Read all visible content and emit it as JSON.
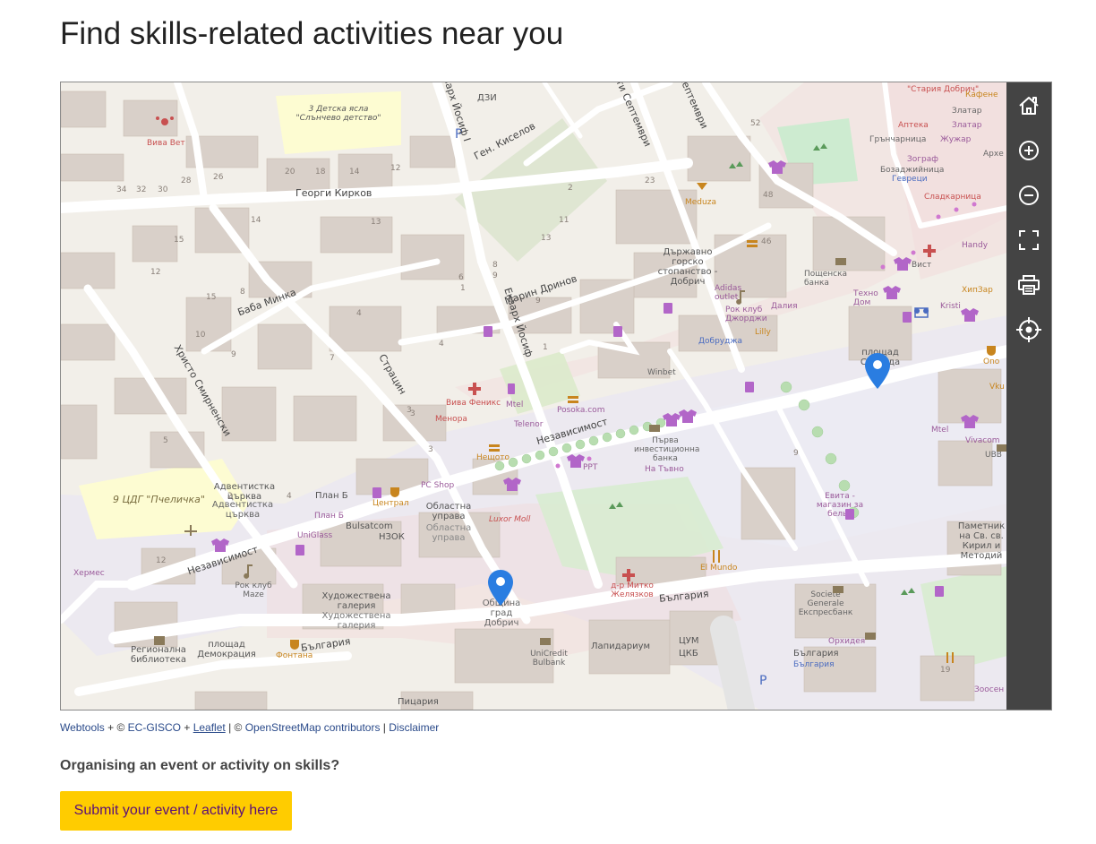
{
  "page": {
    "title": "Find skills-related activities near you"
  },
  "map": {
    "streets": {
      "georgi_kirkov": "Георги Кирков",
      "gen_kiselov": "Ген. Киселов",
      "baba_minka": "Баба Минка",
      "hristo_smirnenski": "Христо Смирненски",
      "stratsin": "Страцин",
      "ekzarh_yosif": "Екзарх Йосиф",
      "ekzarh_yosif_top": "Екзарх Йосиф I",
      "marin_drinov": "Марин Дринов",
      "nezavisimost": "Независимост",
      "nezavisimost_west": "Независимост",
      "balgariya": "България",
      "balgariya_west": "България",
      "25_septemvri": "25-ти Септември",
      "septemvri": "Септември"
    },
    "places": {
      "dzi": "ДЗИ",
      "detska_yasla": "3 Детска ясла \"Слънчево детство\"",
      "viva_vet": "Вива Вет",
      "darzhavno": "Държавно горско стопанство - Добрич",
      "meduza": "Meduza",
      "adidas": "Adidas outlet",
      "rok_klub_dzhordzhi": "Рок клуб Джорджи",
      "lilly": "Lilly",
      "daliya": "Далия",
      "dobrudzha": "Добруджа",
      "winbet": "Winbet",
      "poshtenska": "Пощенска банка",
      "tehno_dom": "Техно Дом",
      "ploshtad_svoboda": "площад Свобода",
      "stariya_dobrich": "\"Стария Добрич\"",
      "apteka": "Аптека",
      "zlatar1": "Златар",
      "zlatar2": "Златар",
      "kafene": "Кафене",
      "grancharnitsa": "Грънчарница",
      "bozadzhiinitsa": "Бозаджийница",
      "zhuzhar": "Жужар",
      "zograf": "Зограф",
      "gevrek": "Гевреци",
      "sladkarnitsa": "Сладкарница",
      "arhe": "Архе",
      "handy": "Handy",
      "vist": "Вист",
      "hipzar": "ХипЗар",
      "kristi": "Kristi",
      "ono": "Ono",
      "viva_fenix": "Вива Феникс",
      "menora": "Менора",
      "mtel1": "Mtel",
      "telenor": "Telenor",
      "posoka": "Posoka.com",
      "purva_banka": "Първа инвестиционна банка",
      "na_tvono": "На Тъвно",
      "ppt": "PPT",
      "neshto": "Нещото",
      "pc_shop": "PC Shop",
      "oblastna_uprava": "Областна управа",
      "oblastna_uprava2": "Областна управа",
      "tsentral": "Централ",
      "bulsatcom": "Bulsatcom",
      "nzok": "НЗОК",
      "luxor_moll": "Luxor Moll",
      "plan_b": "План Б",
      "plan_b2": "План Б",
      "adventistka": "Адвентистка църква",
      "adventistka2": "Адвентистка църква",
      "tsdg": "9 ЦДГ \"Пчеличка\"",
      "uniglass": "UniGlass",
      "hermes": "Хермес",
      "rok_klub_maze": "Рок клуб Maze",
      "hudozhestvena": "Художествена галерия",
      "hudozhestvena2": "Художествена галерия",
      "obshtina": "Община град Добрич",
      "regionalna": "Регионална библиотека",
      "ploshtad_demokratsiya": "площад Демокрация",
      "fontana": "Фонтана",
      "unicredit": "UniCredit Bulbank",
      "laplandiyum": "Лапидариум",
      "tsum": "ЦУМ",
      "tsum2": "ЦКБ",
      "pitsariya": "Пицария",
      "dr_mitko": "д-р Митко Желязков",
      "el_mundo": "El Mundo",
      "societe": "Societe Generale Експресбанк",
      "orhideya": "Орхидея",
      "balgariya_hotel": "България",
      "balgariya_hotel2": "България",
      "evita": "Евита - магазин за бельо",
      "pametnik": "Паметник на Св. св. Кирил и Методий",
      "mtel2": "Mtel",
      "vivacom": "Vivacom",
      "ubb": "UBB",
      "vku": "Vku",
      "zoosen": "Зоосен"
    },
    "house_numbers": [
      "34",
      "32",
      "30",
      "28",
      "26",
      "20",
      "18",
      "14",
      "12",
      "14",
      "13",
      "15",
      "12",
      "15",
      "10",
      "7",
      "9",
      "5",
      "3",
      "4",
      "8",
      "12",
      "9",
      "2",
      "11",
      "9",
      "3",
      "8",
      "23",
      "52",
      "48",
      "46",
      "9",
      "19",
      "6",
      "1",
      "4",
      "13",
      "1",
      "3",
      "4",
      "2"
    ],
    "markers": [
      {
        "name": "location-marker-ploshtad-svoboda",
        "color": "#2a7de1"
      },
      {
        "name": "location-marker-obshtina",
        "color": "#2a7de1"
      }
    ]
  },
  "toolbar": {
    "home": "home-icon",
    "zoom_in": "zoom-in-icon",
    "zoom_out": "zoom-out-icon",
    "fullscreen": "fullscreen-icon",
    "print": "print-icon",
    "locate": "locate-icon"
  },
  "attribution": {
    "webtools": "Webtools",
    "plus1": " + © ",
    "ec_gisco": "EC-GISCO",
    "plus2": " + ",
    "leaflet": "Leaflet",
    "bar1": " | © ",
    "osm": "OpenStreetMap contributors",
    "bar2": " | ",
    "disclaimer": "Disclaimer"
  },
  "organise": {
    "heading": "Organising an event or activity on skills?",
    "button_label": "Submit your event / activity here"
  },
  "colors": {
    "toolbar_bg": "#444444",
    "button_bg": "#ffcc00",
    "button_text": "#5a0e78",
    "marker": "#2a7de1",
    "link": "#2a4a8a"
  }
}
